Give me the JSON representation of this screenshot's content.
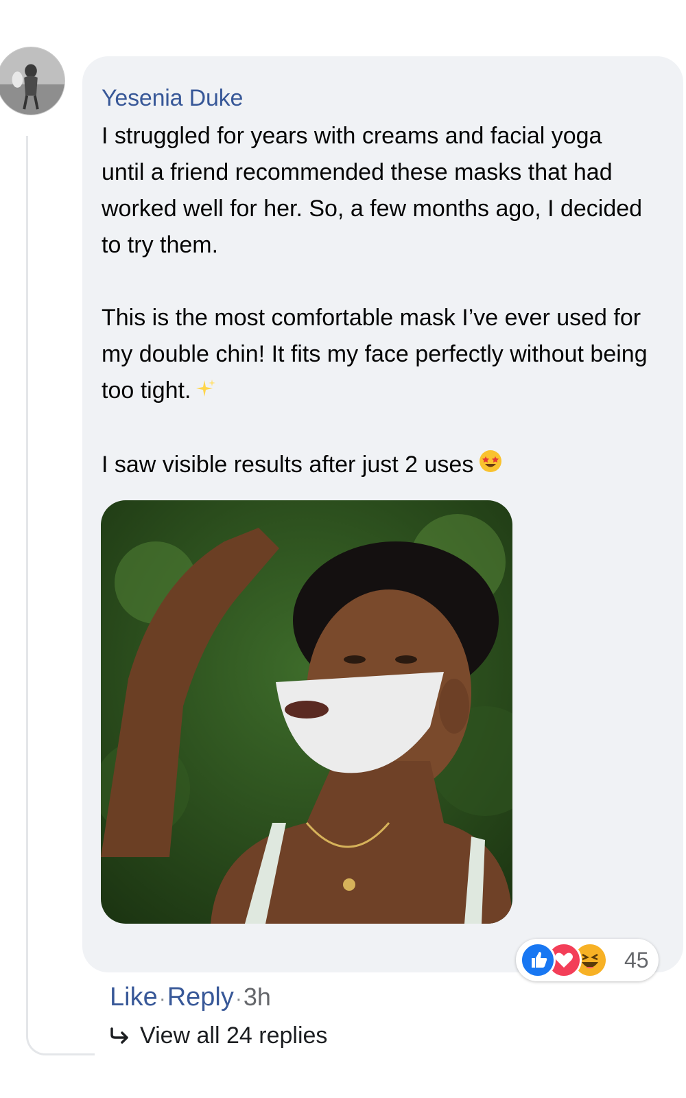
{
  "comment": {
    "author": "Yesenia Duke",
    "paragraphs": {
      "p1": "I struggled for years with creams and facial yoga until a friend recommended these masks that had worked well for her. So, a few months ago, I decided to try them.",
      "p2": "This is the most comfortable mask I’ve ever used for my double chin! It fits my face perfectly without being too tight.",
      "p3": "I saw visible results after just 2 uses"
    },
    "emojis": {
      "sparkles": "sparkles-emoji",
      "star_struck": "star-struck-emoji"
    },
    "reactions": {
      "icons": [
        "like-reaction-icon",
        "love-reaction-icon",
        "haha-reaction-icon"
      ],
      "count": "45"
    },
    "actions": {
      "like": "Like",
      "sep": "·",
      "reply": "Reply",
      "time": "3h"
    },
    "view_replies": "View all 24 replies"
  },
  "colors": {
    "author": "#385898",
    "bubble": "#f0f2f5",
    "like": "#1877f2",
    "love": "#f33e58",
    "haha": "#f7b125"
  }
}
